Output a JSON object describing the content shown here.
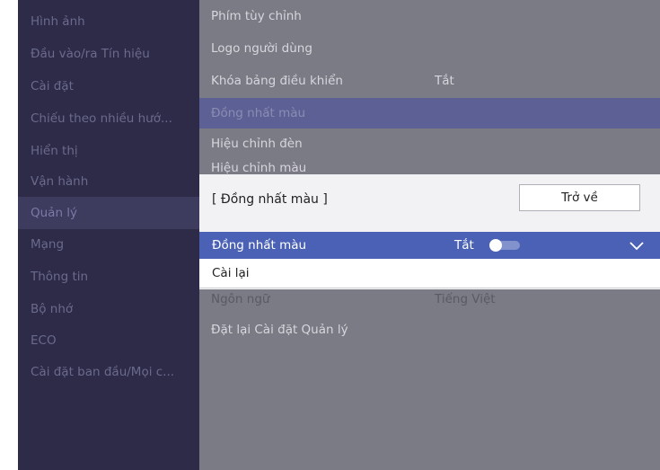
{
  "sidebar": {
    "items": [
      {
        "label": "Hình ảnh"
      },
      {
        "label": "Đầu vào/ra Tín hiệu"
      },
      {
        "label": "Cài đặt"
      },
      {
        "label": "Chiếu theo nhiều hướ..."
      },
      {
        "label": "Hiển thị"
      },
      {
        "label": "Vận hành"
      },
      {
        "label": "Quản lý"
      },
      {
        "label": "Mạng"
      },
      {
        "label": "Thông tin"
      },
      {
        "label": "Bộ nhớ"
      },
      {
        "label": "ECO"
      },
      {
        "label": "Cài đặt ban đầu/Mọi c..."
      }
    ],
    "selected_index": 6
  },
  "main": {
    "rows": [
      {
        "label": "Phím tùy chỉnh",
        "value": ""
      },
      {
        "label": "Logo người dùng",
        "value": ""
      },
      {
        "label": "Khóa bảng điều khiển",
        "value": "Tắt"
      },
      {
        "label": "Đồng nhất màu",
        "value": ""
      },
      {
        "label": "Hiệu chỉnh đèn",
        "value": ""
      },
      {
        "label": "Hiệu chỉnh màu",
        "value": ""
      },
      {
        "label": "Ngôn ngữ",
        "value": "Tiếng Việt"
      },
      {
        "label": "Đặt lại Cài đặt Quản lý",
        "value": ""
      }
    ],
    "highlighted_index": 3
  },
  "dialog": {
    "title": "[ Đồng nhất màu ]",
    "back_label": "Trở về",
    "options": [
      {
        "label": "Đồng nhất màu",
        "value": "Tắt",
        "toggle_on": false
      },
      {
        "label": "Cài lại"
      }
    ]
  },
  "colors": {
    "sidebar_bg": "#2d2b47",
    "screen_bg": "#7b7b85",
    "highlight": "#4a61b6"
  }
}
